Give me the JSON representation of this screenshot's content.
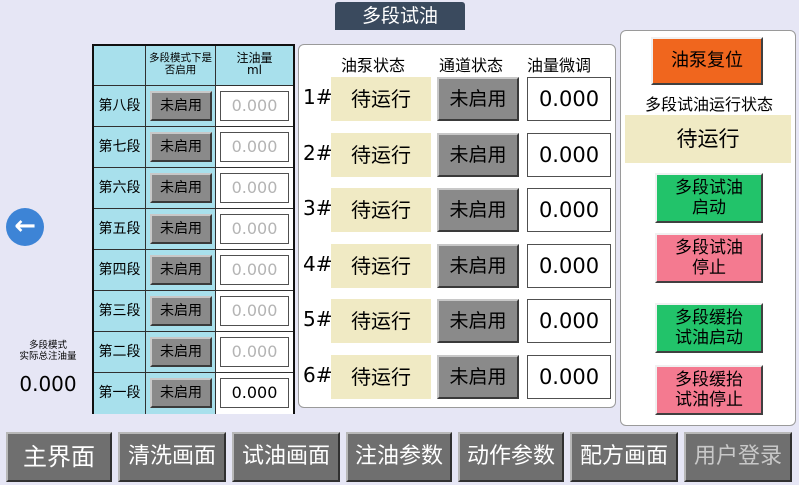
{
  "window": {
    "title": "多段试油"
  },
  "left": {
    "total_label_line1": "多段模式",
    "total_label_line2": "实际总注油量",
    "total_value": "0.000"
  },
  "segments": {
    "header_enable": "多段模式下是否启用",
    "header_amount_line1": "注油量",
    "header_amount_line2": "ml",
    "rows": [
      {
        "name": "第八段",
        "enable": "未启用",
        "amount": "0.000"
      },
      {
        "name": "第七段",
        "enable": "未启用",
        "amount": "0.000"
      },
      {
        "name": "第六段",
        "enable": "未启用",
        "amount": "0.000"
      },
      {
        "name": "第五段",
        "enable": "未启用",
        "amount": "0.000"
      },
      {
        "name": "第四段",
        "enable": "未启用",
        "amount": "0.000"
      },
      {
        "name": "第三段",
        "enable": "未启用",
        "amount": "0.000"
      },
      {
        "name": "第二段",
        "enable": "未启用",
        "amount": "0.000"
      },
      {
        "name": "第一段",
        "enable": "未启用",
        "amount": "0.000"
      }
    ]
  },
  "pumps": {
    "header_status": "油泵状态",
    "header_channel": "通道状态",
    "header_adjust": "油量微调",
    "rows": [
      {
        "num": "1#",
        "status": "待运行",
        "channel": "未启用",
        "adjust": "0.000"
      },
      {
        "num": "2#",
        "status": "待运行",
        "channel": "未启用",
        "adjust": "0.000"
      },
      {
        "num": "3#",
        "status": "待运行",
        "channel": "未启用",
        "adjust": "0.000"
      },
      {
        "num": "4#",
        "status": "待运行",
        "channel": "未启用",
        "adjust": "0.000"
      },
      {
        "num": "5#",
        "status": "待运行",
        "channel": "未启用",
        "adjust": "0.000"
      },
      {
        "num": "6#",
        "status": "待运行",
        "channel": "未启用",
        "adjust": "0.000"
      }
    ]
  },
  "right": {
    "reset_label": "油泵复位",
    "run_status_label": "多段试油运行状态",
    "run_status_value": "待运行",
    "start_line1": "多段试油",
    "start_line2": "启动",
    "stop_line1": "多段试油",
    "stop_line2": "停止",
    "slow_start_line1": "多段缓抬",
    "slow_start_line2": "试油启动",
    "slow_stop_line1": "多段缓抬",
    "slow_stop_line2": "试油停止"
  },
  "nav": {
    "items": [
      "主界面",
      "清洗画面",
      "试油画面",
      "注油参数",
      "动作参数",
      "配方画面",
      "用户登录"
    ]
  },
  "icons": {
    "back": "arrow-left-icon"
  },
  "colors": {
    "title_bg": "#3a4a5e",
    "reset": "#f0661e",
    "start_green": "#22c36a",
    "stop_pink": "#f47a90",
    "status_bg": "#f0eac4",
    "segment_bg": "#a8e0ec"
  }
}
